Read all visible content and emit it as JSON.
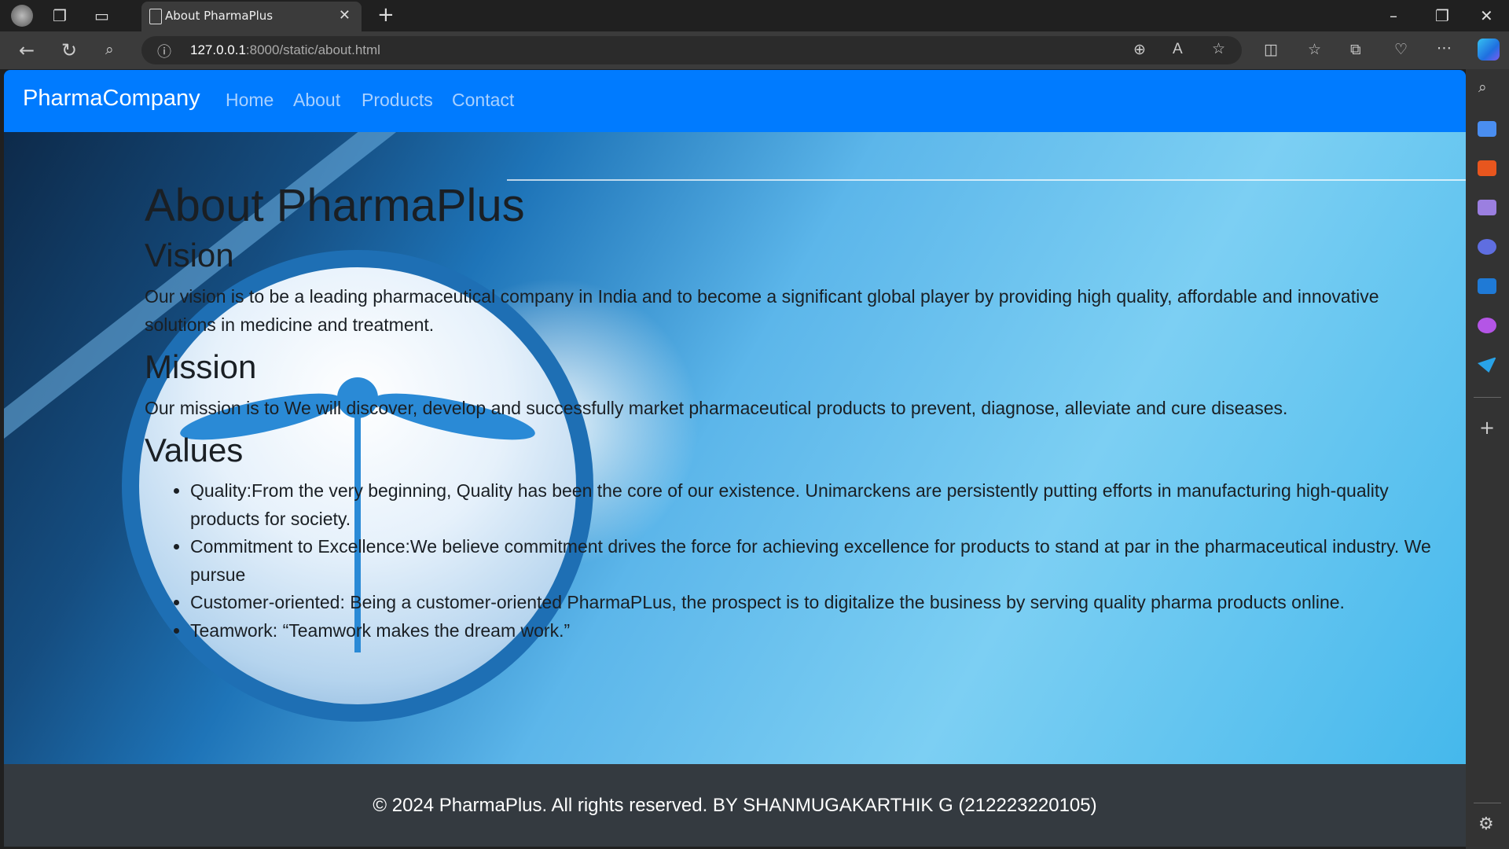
{
  "browser": {
    "tab_title": "About PharmaPlus",
    "url_host": "127.0.0.1",
    "url_rest": ":8000/static/about.html"
  },
  "navbar": {
    "brand": "PharmaCompany",
    "links": [
      "Home",
      "About",
      "Products",
      "Contact"
    ],
    "color": "#007bff"
  },
  "main": {
    "title": "About PharmaPlus",
    "vision_heading": "Vision",
    "vision_text": "Our vision is to be a leading pharmaceutical company in India and to become a significant global player by providing high quality, affordable and innovative solutions in medicine and treatment.",
    "mission_heading": "Mission",
    "mission_text": "Our mission is to We will discover, develop and successfully market pharmaceutical products to prevent, diagnose, alleviate and cure diseases.",
    "values_heading": "Values",
    "values": [
      "Quality:From the very beginning, Quality has been the core of our existence. Unimarckens are persistently putting efforts in manufacturing high-quality products for society.",
      "Commitment to Excellence:We believe commitment drives the force for achieving excellence for products to stand at par in the pharmaceutical industry. We pursue",
      "Customer-oriented: Being a customer-oriented PharmaPLus, the prospect is to digitalize the business by serving quality pharma products online.",
      "Teamwork: “Teamwork makes the dream work.”"
    ]
  },
  "footer": {
    "text": "© 2024 PharmaPlus. All rights reserved. BY SHANMUGAKARTHIK G (212223220105)"
  }
}
